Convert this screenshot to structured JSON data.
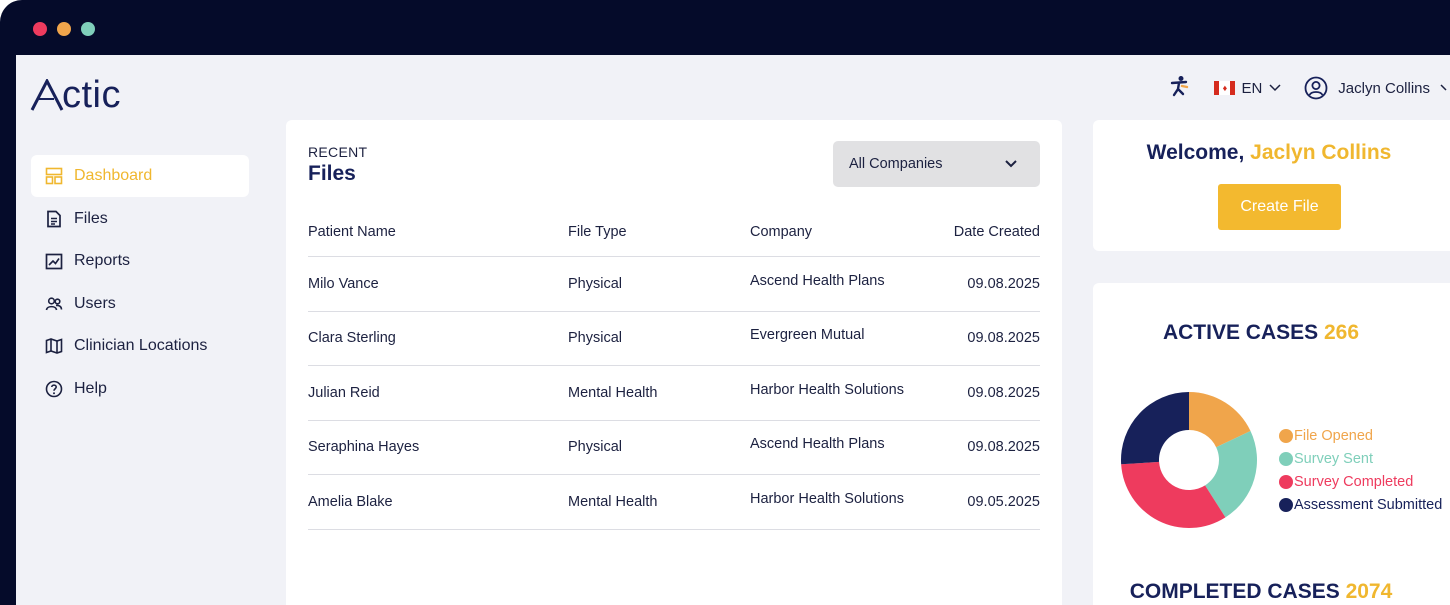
{
  "window": {
    "dots": [
      "#ee3b5e",
      "#f0a54b",
      "#7fcfba"
    ]
  },
  "brand": {
    "logo_text": "ctic"
  },
  "topbar": {
    "language": "EN",
    "user_name": "Jaclyn Collins"
  },
  "sidebar": {
    "items": [
      {
        "label": "Dashboard",
        "icon": "dashboard-icon",
        "active": true
      },
      {
        "label": "Files",
        "icon": "file-icon"
      },
      {
        "label": "Reports",
        "icon": "reports-icon"
      },
      {
        "label": "Users",
        "icon": "users-icon"
      },
      {
        "label": "Clinician Locations",
        "icon": "map-icon"
      },
      {
        "label": "Help",
        "icon": "help-icon"
      }
    ]
  },
  "files_card": {
    "eyebrow": "RECENT",
    "title": "Files",
    "filter_value": "All Companies",
    "columns": [
      "Patient Name",
      "File Type",
      "Company",
      "Date Created"
    ],
    "rows": [
      [
        "Milo Vance",
        "Physical",
        "Ascend Health Plans",
        "09.08.2025"
      ],
      [
        "Clara Sterling",
        "Physical",
        "Evergreen Mutual",
        "09.08.2025"
      ],
      [
        "Julian Reid",
        "Mental Health",
        "Harbor Health Solutions",
        "09.08.2025"
      ],
      [
        "Seraphina Hayes",
        "Physical",
        "Ascend Health Plans",
        "09.08.2025"
      ],
      [
        "Amelia Blake",
        "Mental Health",
        "Harbor Health Solutions",
        "09.05.2025"
      ]
    ]
  },
  "welcome_card": {
    "greeting": "Welcome,",
    "name": "Jaclyn Collins",
    "create_label": "Create File"
  },
  "cases_card": {
    "active_label": "ACTIVE CASES",
    "active_count": "266",
    "completed_label": "COMPLETED CASES",
    "completed_count": "2074"
  },
  "chart_data": {
    "type": "pie",
    "donut": true,
    "categories": [
      "File Opened",
      "Survey Sent",
      "Survey Completed",
      "Assessment Submitted"
    ],
    "values": [
      18,
      23,
      33,
      26
    ],
    "colors": [
      "#f0a54b",
      "#7fcfba",
      "#ee3b5e",
      "#17215a"
    ],
    "legend_position": "right"
  },
  "colors": {
    "accent": "#f0b72f",
    "navy": "#17215a",
    "button": "#f3b92f"
  }
}
